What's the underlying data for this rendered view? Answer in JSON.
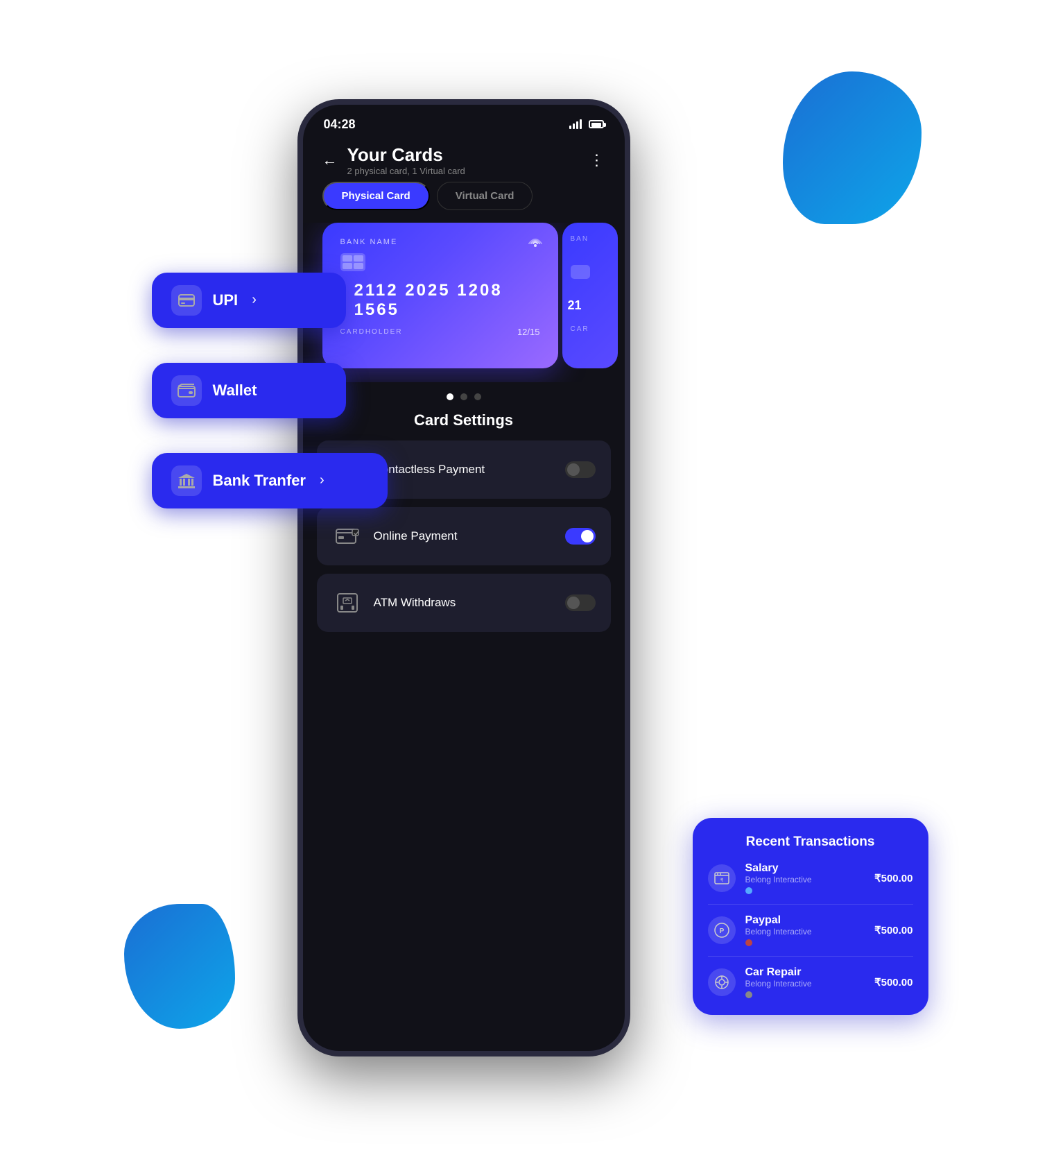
{
  "status_bar": {
    "time": "04:28",
    "battery_label": "battery"
  },
  "header": {
    "back_label": "←",
    "title": "Your Cards",
    "subtitle": "2 physical card, 1 Virtual card",
    "more_label": "⋮"
  },
  "tabs": [
    {
      "label": "Physical Card",
      "active": true
    },
    {
      "label": "Virtual Card",
      "active": false
    }
  ],
  "card": {
    "bank_name_label": "BANK NAME",
    "number": "2112  2025  1208  1565",
    "cardholder_label": "CARDHOLDER",
    "expiry": "12/15",
    "nfc_symbol": ")))·"
  },
  "carousel_dots": [
    {
      "active": true
    },
    {
      "active": false
    },
    {
      "active": false
    }
  ],
  "card_settings": {
    "title": "Card Settings",
    "items": [
      {
        "label": "Contactless Payment",
        "icon": "📶",
        "toggle": "off"
      },
      {
        "label": "Online Payment",
        "icon": "💳",
        "toggle": "on"
      },
      {
        "label": "ATM Withdraws",
        "icon": "🏧",
        "toggle": "off"
      }
    ]
  },
  "pills": [
    {
      "id": "upi",
      "icon": "💳",
      "label": "UPI",
      "chevron": "›"
    },
    {
      "id": "wallet",
      "icon": "👛",
      "label": "Wallet",
      "chevron": ""
    },
    {
      "id": "bank",
      "icon": "🏛",
      "label": "Bank Tranfer",
      "chevron": "›"
    }
  ],
  "transactions": {
    "title": "Recent Transactions",
    "items": [
      {
        "name": "Salary",
        "sub": "Belong Interactive",
        "amount": "₹500.00",
        "icon": "📅",
        "indicator": "blue"
      },
      {
        "name": "Paypal",
        "sub": "Belong Interactive",
        "amount": "₹500.00",
        "icon": "🅿",
        "indicator": "purple"
      },
      {
        "name": "Car Repair",
        "sub": "Belong Interactive",
        "amount": "₹500.00",
        "icon": "⚙",
        "indicator": "gray"
      }
    ]
  }
}
